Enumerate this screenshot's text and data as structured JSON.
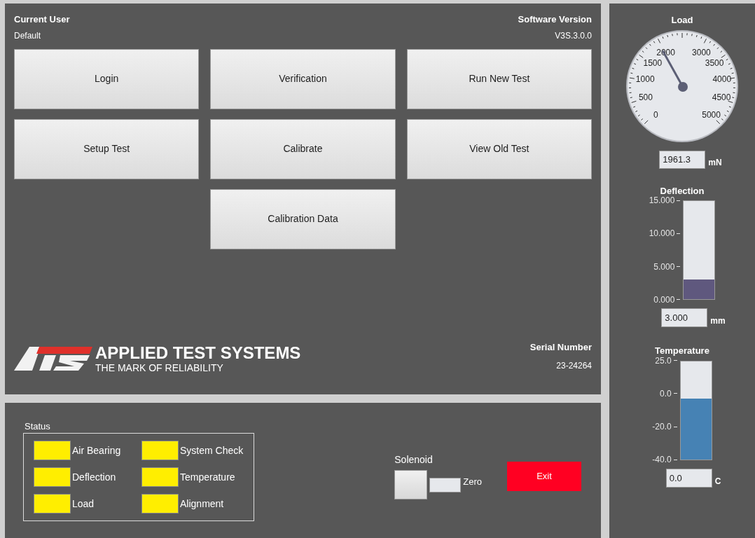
{
  "user": {
    "label": "Current User",
    "value": "Default"
  },
  "software": {
    "label": "Software Version",
    "value": "V3S.3.0.0"
  },
  "buttons": [
    {
      "label": "Login"
    },
    {
      "label": "Verification"
    },
    {
      "label": "Run New Test"
    },
    {
      "label": "Setup Test"
    },
    {
      "label": "Calibrate"
    },
    {
      "label": "View Old Test"
    },
    {
      "label": "Calibration Data"
    }
  ],
  "logo": {
    "title": "APPLIED TEST SYSTEMS",
    "tagline": "THE MARK OF RELIABILITY"
  },
  "serial": {
    "label": "Serial Number",
    "value": "23-24264"
  },
  "status": {
    "title": "Status",
    "lights": [
      {
        "label": "Air Bearing",
        "color": "#ffee00"
      },
      {
        "label": "System Check",
        "color": "#ffee00"
      },
      {
        "label": "Deflection",
        "color": "#ffee00"
      },
      {
        "label": "Temperature",
        "color": "#ffee00"
      },
      {
        "label": "Load",
        "color": "#ffee00"
      },
      {
        "label": "Alignment",
        "color": "#ffee00"
      }
    ]
  },
  "solenoid": {
    "label": "Solenoid",
    "zero_label": "Zero"
  },
  "exit": {
    "label": "Exit"
  },
  "load": {
    "title": "Load",
    "level": 0.392,
    "reading": "1961.3",
    "unit": "mN",
    "scale": [
      "0",
      "500",
      "1000",
      "1500",
      "2000",
      "3000",
      "3500",
      "4000",
      "4500",
      "5000"
    ]
  },
  "deflection": {
    "title": "Deflection",
    "level": 0.2,
    "reading": "3.000",
    "unit": "mm",
    "scale": [
      "15.000",
      "10.000",
      "5.000",
      "0.000"
    ]
  },
  "temperature": {
    "title": "Temperature",
    "level": 0.615,
    "reading": "0.0",
    "unit": "C",
    "scale": [
      "25.0",
      "0.0",
      "-20.0",
      "-40.0"
    ]
  }
}
